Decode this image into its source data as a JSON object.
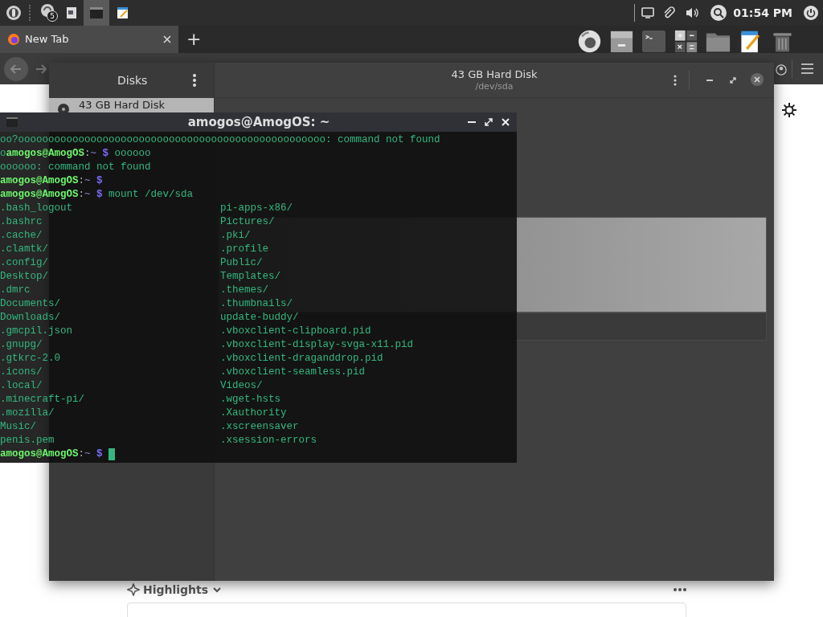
{
  "top_panel": {
    "badge": "5",
    "clock": "01:54 PM"
  },
  "browser": {
    "tabs": [
      {
        "label": "New Tab",
        "selected": true
      }
    ],
    "new_tab": "+",
    "section": "Highlights"
  },
  "disks": {
    "sidebar_title": "Disks",
    "drives": [
      {
        "label": "43 GB Hard Disk",
        "selected": true
      }
    ],
    "title": "43 GB Hard Disk",
    "subtitle": "/dev/sda"
  },
  "terminal": {
    "title": "amogos@AmogOS: ~",
    "lines": [
      {
        "kind": "output",
        "text": "oo?ooooooooooooooooooooooooooooooooooooooooooooooooooo: command not found"
      },
      {
        "kind": "prompt",
        "pre": "o",
        "user": "amogos@AmogOS",
        "sep": ":",
        "path": "~",
        "symbol": "$",
        "command": "oooooo"
      },
      {
        "kind": "output",
        "text": "oooooo: command not found"
      },
      {
        "kind": "prompt",
        "user": "amogos@AmogOS",
        "sep": ":",
        "path": "~",
        "symbol": "$"
      },
      {
        "kind": "prompt",
        "user": "amogos@AmogOS",
        "sep": ":",
        "path": "~",
        "symbol": "$",
        "command": "mount /dev/sda"
      }
    ],
    "listing": {
      "column_1": [
        ".bash_logout",
        ".bashrc",
        ".cache/",
        ".clamtk/",
        ".config/",
        "Desktop/",
        ".dmrc",
        "Documents/",
        "Downloads/",
        ".gmcpil.json",
        ".gnupg/",
        ".gtkrc-2.0",
        ".icons/",
        ".local/",
        ".minecraft-pi/",
        ".mozilla/",
        "Music/",
        "penis.pem"
      ],
      "column_2": [
        "pi-apps-x86/",
        "Pictures/",
        ".pki/",
        ".profile",
        "Public/",
        "Templates/",
        ".themes/",
        ".thumbnails/",
        "update-buddy/",
        ".vboxclient-clipboard.pid",
        ".vboxclient-display-svga-x11.pid",
        ".vboxclient-draganddrop.pid",
        ".vboxclient-seamless.pid",
        "Videos/",
        ".wget-hsts",
        ".Xauthority",
        ".xscreensaver",
        ".xsession-errors"
      ]
    },
    "final_prompt": {
      "kind": "prompt",
      "user": "amogos@AmogOS",
      "sep": ":",
      "path": "~",
      "symbol": "$",
      "cursor": true
    }
  }
}
